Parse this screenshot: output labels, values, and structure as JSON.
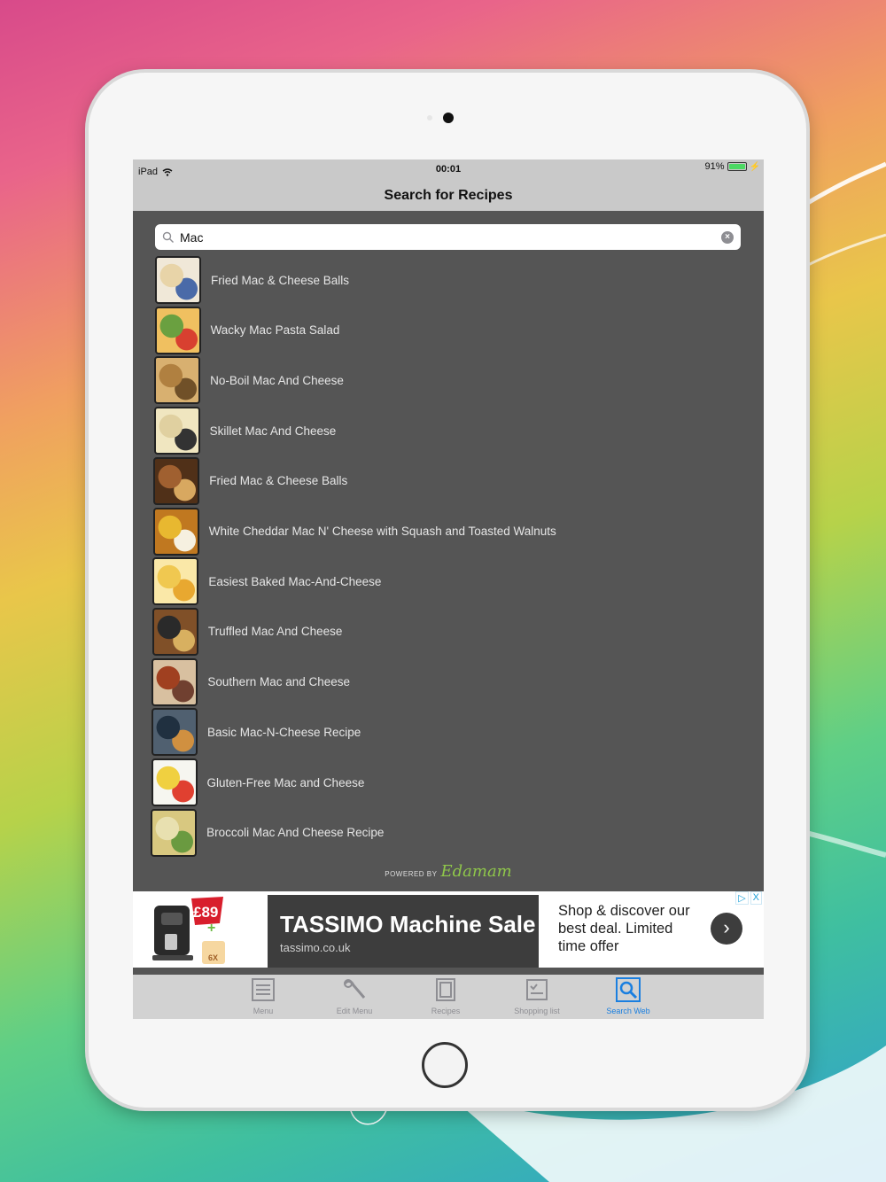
{
  "status_bar": {
    "device": "iPad",
    "time": "00:01",
    "battery": "91%"
  },
  "nav": {
    "title": "Search for Recipes"
  },
  "search": {
    "value": "Mac",
    "placeholder": ""
  },
  "results": [
    {
      "label": "Fried Mac & Cheese Balls",
      "thumb_colors": [
        "#e8d4a8",
        "#4a6aa8",
        "#f0e8d8"
      ]
    },
    {
      "label": "Wacky Mac Pasta Salad",
      "thumb_colors": [
        "#6aa040",
        "#d84030",
        "#f0c060"
      ]
    },
    {
      "label": "No-Boil Mac And Cheese",
      "thumb_colors": [
        "#b08040",
        "#705028",
        "#d8b070"
      ]
    },
    {
      "label": "Skillet Mac And Cheese",
      "thumb_colors": [
        "#e0d0a0",
        "#333333",
        "#f0e6c0"
      ]
    },
    {
      "label": "Fried Mac & Cheese Balls",
      "thumb_colors": [
        "#a06030",
        "#d8a860",
        "#503018"
      ]
    },
    {
      "label": "White Cheddar Mac N' Cheese with Squash and Toasted Walnuts",
      "thumb_colors": [
        "#e8b830",
        "#f6f0e0",
        "#c07820"
      ]
    },
    {
      "label": "Easiest Baked Mac-And-Cheese",
      "thumb_colors": [
        "#f0c850",
        "#e8a830",
        "#fae8a8"
      ]
    },
    {
      "label": "Truffled Mac And Cheese",
      "thumb_colors": [
        "#2a2a2a",
        "#d8b060",
        "#805028"
      ]
    },
    {
      "label": "Southern Mac and Cheese",
      "thumb_colors": [
        "#a04020",
        "#704030",
        "#d8c0a0"
      ]
    },
    {
      "label": "Basic Mac-N-Cheese Recipe",
      "thumb_colors": [
        "#203040",
        "#d09040",
        "#506070"
      ]
    },
    {
      "label": "Gluten-Free Mac and Cheese",
      "thumb_colors": [
        "#f0d040",
        "#e04030",
        "#f6f6f0"
      ]
    },
    {
      "label": "Broccoli Mac And Cheese Recipe",
      "thumb_colors": [
        "#e8e0b0",
        "#6a9a40",
        "#d8c880"
      ]
    }
  ],
  "powered": {
    "prefix": "POWERED BY",
    "brand": "Edamam"
  },
  "ad": {
    "price_badge": "£89",
    "pack_label": "6X",
    "title": "TASSIMO Machine Sale",
    "domain": "tassimo.co.uk",
    "copy": "Shop & discover our best deal. Limited time offer",
    "go_icon": "›",
    "adchoices_icon": "▷",
    "close_icon": "X"
  },
  "tabs": [
    {
      "label": "Menu",
      "icon": "menu-icon",
      "active": false
    },
    {
      "label": "Edit Menu",
      "icon": "edit-menu-icon",
      "active": false
    },
    {
      "label": "Recipes",
      "icon": "recipes-icon",
      "active": false
    },
    {
      "label": "Shopping list",
      "icon": "shopping-list-icon",
      "active": false
    },
    {
      "label": "Search Web",
      "icon": "search-web-icon",
      "active": true
    }
  ],
  "colors": {
    "screen_bg": "#555555",
    "bar_bg": "#c9c9c9",
    "active_tab": "#1a7fe0",
    "edamam_green": "#8fc74a"
  }
}
